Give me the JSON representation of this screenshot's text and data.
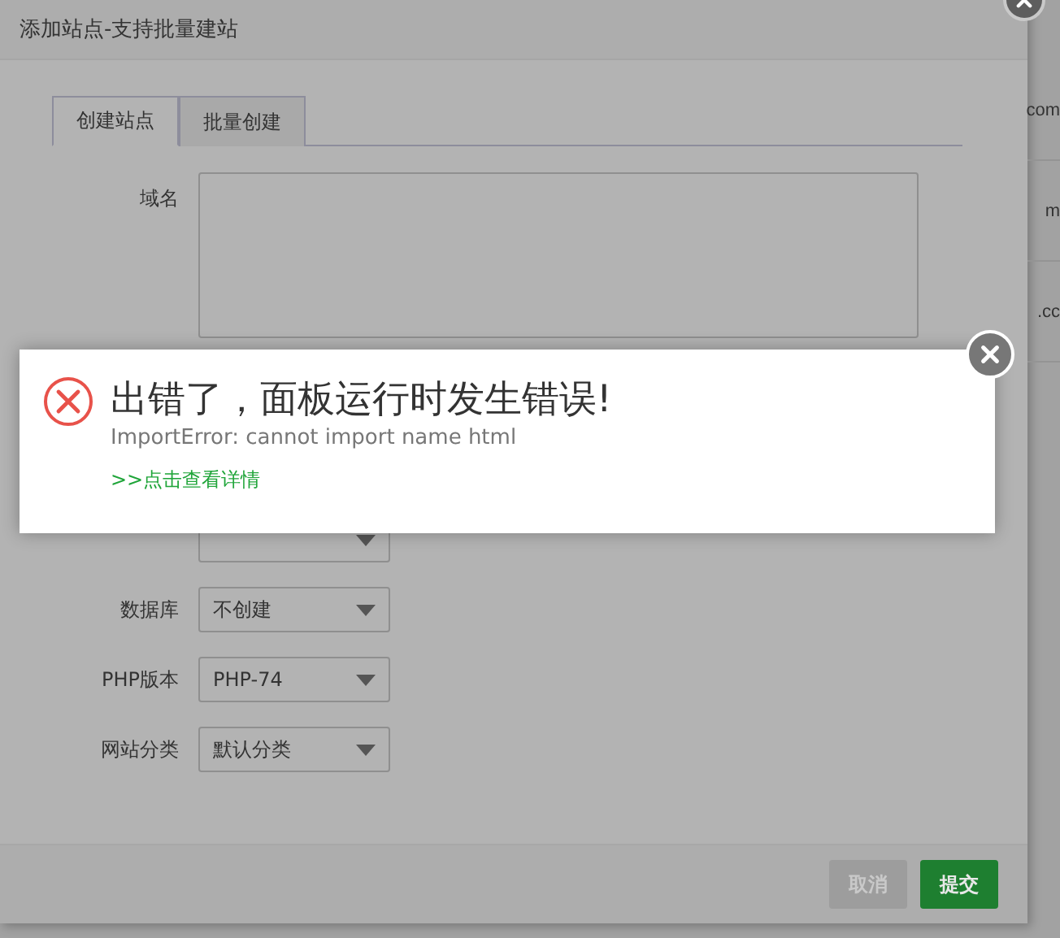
{
  "dialog": {
    "title": "添加站点-支持批量建站",
    "tabs": [
      {
        "label": "创建站点",
        "selected": true
      },
      {
        "label": "批量创建",
        "selected": false
      }
    ],
    "domain": {
      "label": "域名"
    },
    "rows": [
      {
        "kind": "covered"
      },
      {
        "label": "数据库",
        "value": "不创建"
      },
      {
        "label": "PHP版本",
        "value": "PHP-74"
      },
      {
        "label": "网站分类",
        "value": "默认分类"
      }
    ],
    "buttons": [
      {
        "label": "取消",
        "kind": "secondary"
      },
      {
        "label": "提交",
        "kind": "primary"
      }
    ]
  },
  "background_list": [
    "com",
    "m",
    ".cc"
  ],
  "error_toast": {
    "title": "出错了，面板运行时发生错误!",
    "message": "ImportError: cannot import name html",
    "link": ">>点击查看详情"
  }
}
